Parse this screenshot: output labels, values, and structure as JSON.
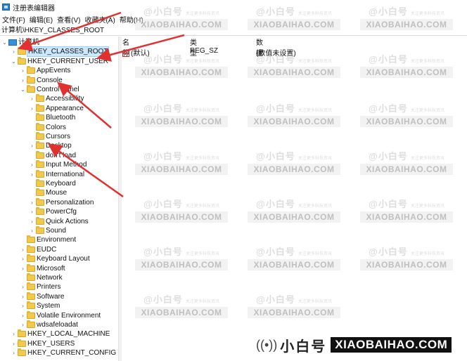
{
  "window": {
    "title": "注册表编辑器"
  },
  "menu": [
    "文件(F)",
    "编辑(E)",
    "查看(V)",
    "收藏夹(A)",
    "帮助(H)"
  ],
  "address": "计算机\\HKEY_CLASSES_ROOT",
  "tree": [
    {
      "label": "计算机",
      "depth": 0,
      "expand": "open",
      "icon": "computer-icon"
    },
    {
      "label": "HKEY_CLASSES_ROOT",
      "depth": 1,
      "expand": "closed",
      "icon": "folder-icon",
      "selected": true
    },
    {
      "label": "HKEY_CURRENT_USER",
      "depth": 1,
      "expand": "open",
      "icon": "folder-icon"
    },
    {
      "label": "AppEvents",
      "depth": 2,
      "expand": "closed",
      "icon": "folder-icon"
    },
    {
      "label": "Console",
      "depth": 2,
      "expand": "closed",
      "icon": "folder-icon"
    },
    {
      "label": "Control Panel",
      "depth": 2,
      "expand": "open",
      "icon": "folder-icon"
    },
    {
      "label": "Accessibility",
      "depth": 3,
      "expand": "closed",
      "icon": "folder-icon"
    },
    {
      "label": "Appearance",
      "depth": 3,
      "expand": "closed",
      "icon": "folder-icon"
    },
    {
      "label": "Bluetooth",
      "depth": 3,
      "expand": "none",
      "icon": "folder-icon"
    },
    {
      "label": "Colors",
      "depth": 3,
      "expand": "none",
      "icon": "folder-icon"
    },
    {
      "label": "Cursors",
      "depth": 3,
      "expand": "none",
      "icon": "folder-icon"
    },
    {
      "label": "Desktop",
      "depth": 3,
      "expand": "closed",
      "icon": "folder-icon"
    },
    {
      "label": "don't load",
      "depth": 3,
      "expand": "none",
      "icon": "folder-icon"
    },
    {
      "label": "Input Method",
      "depth": 3,
      "expand": "closed",
      "icon": "folder-icon"
    },
    {
      "label": "International",
      "depth": 3,
      "expand": "closed",
      "icon": "folder-icon"
    },
    {
      "label": "Keyboard",
      "depth": 3,
      "expand": "none",
      "icon": "folder-icon"
    },
    {
      "label": "Mouse",
      "depth": 3,
      "expand": "none",
      "icon": "folder-icon"
    },
    {
      "label": "Personalization",
      "depth": 3,
      "expand": "closed",
      "icon": "folder-icon"
    },
    {
      "label": "PowerCfg",
      "depth": 3,
      "expand": "closed",
      "icon": "folder-icon"
    },
    {
      "label": "Quick Actions",
      "depth": 3,
      "expand": "closed",
      "icon": "folder-icon"
    },
    {
      "label": "Sound",
      "depth": 3,
      "expand": "closed",
      "icon": "folder-icon"
    },
    {
      "label": "Environment",
      "depth": 2,
      "expand": "none",
      "icon": "folder-icon"
    },
    {
      "label": "EUDC",
      "depth": 2,
      "expand": "closed",
      "icon": "folder-icon"
    },
    {
      "label": "Keyboard Layout",
      "depth": 2,
      "expand": "closed",
      "icon": "folder-icon"
    },
    {
      "label": "Microsoft",
      "depth": 2,
      "expand": "closed",
      "icon": "folder-icon"
    },
    {
      "label": "Network",
      "depth": 2,
      "expand": "none",
      "icon": "folder-icon"
    },
    {
      "label": "Printers",
      "depth": 2,
      "expand": "closed",
      "icon": "folder-icon"
    },
    {
      "label": "Software",
      "depth": 2,
      "expand": "closed",
      "icon": "folder-icon"
    },
    {
      "label": "System",
      "depth": 2,
      "expand": "closed",
      "icon": "folder-icon"
    },
    {
      "label": "Volatile Environment",
      "depth": 2,
      "expand": "closed",
      "icon": "folder-icon"
    },
    {
      "label": "wdsafeloadat",
      "depth": 2,
      "expand": "closed",
      "icon": "folder-icon"
    },
    {
      "label": "HKEY_LOCAL_MACHINE",
      "depth": 1,
      "expand": "closed",
      "icon": "folder-icon"
    },
    {
      "label": "HKEY_USERS",
      "depth": 1,
      "expand": "closed",
      "icon": "folder-icon"
    },
    {
      "label": "HKEY_CURRENT_CONFIG",
      "depth": 1,
      "expand": "closed",
      "icon": "folder-icon"
    }
  ],
  "list": {
    "headers": {
      "name": "名称",
      "type": "类型",
      "data": "数据"
    },
    "rows": [
      {
        "name": "(默认)",
        "type": "REG_SZ",
        "data": "(数值未设置)",
        "icon": "string-value-icon"
      }
    ]
  },
  "watermark": {
    "cn": "@小白号",
    "cn_small": "关注更多科技资讯",
    "en": "XIAOBAIHAO.COM"
  },
  "brand": {
    "icon": "broadcast-icon",
    "cn": "小白号",
    "en": "XIAOBAIHAO.COM"
  },
  "annotation": {
    "arrow_color": "#e03030"
  }
}
